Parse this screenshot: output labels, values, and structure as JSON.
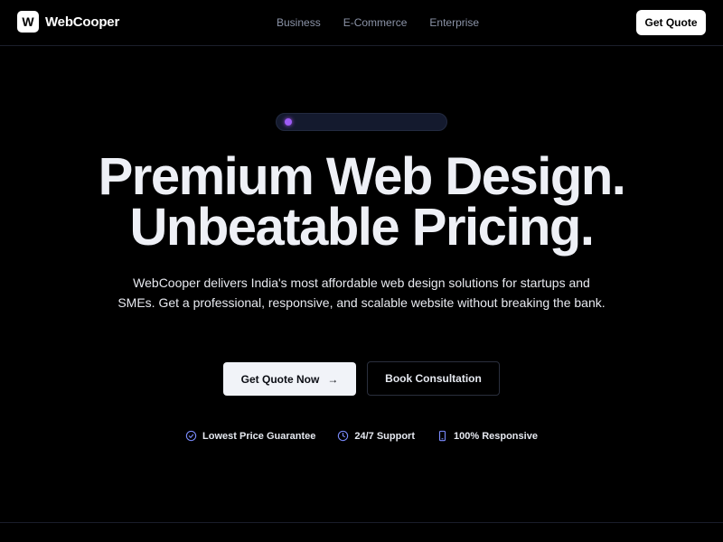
{
  "brand": {
    "logo_letter": "W",
    "name": "WebCooper"
  },
  "nav": {
    "links": [
      "Business",
      "E-Commerce",
      "Enterprise"
    ],
    "cta_label": "Get Quote"
  },
  "hero": {
    "title_line1": "Premium Web Design.",
    "title_line2": "Unbeatable Pricing.",
    "description": "WebCooper delivers India's most affordable web design solutions for startups and SMEs. Get a professional, responsive, and scalable website without breaking the bank.",
    "primary_cta": "Get Quote Now",
    "secondary_cta": "Book Consultation"
  },
  "features": [
    {
      "label": "Lowest Price Guarantee",
      "icon": "check-circle-icon"
    },
    {
      "label": "24/7 Support",
      "icon": "clock-icon"
    },
    {
      "label": "100% Responsive",
      "icon": "smartphone-icon"
    }
  ],
  "colors": {
    "background": "#000000",
    "accent_dot": "#9d5cf6",
    "icon_blue": "#7b8cff",
    "nav_link": "#8b93a7"
  }
}
